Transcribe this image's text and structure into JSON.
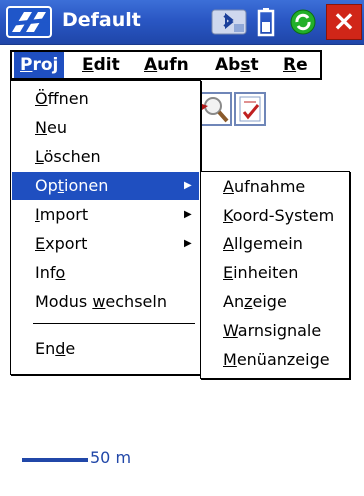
{
  "window": {
    "title": "Default"
  },
  "menubar": {
    "items": [
      {
        "label": "Proj",
        "u": "P",
        "rest": "roj"
      },
      {
        "label": "Edit",
        "u": "E",
        "rest": "dit"
      },
      {
        "label": "Aufn",
        "u": "A",
        "rest": "ufn"
      },
      {
        "label": "Abst",
        "pre": "Ab",
        "u": "s",
        "rest": "t"
      },
      {
        "label": "Re",
        "u": "R",
        "rest": "e"
      }
    ]
  },
  "proj_menu": {
    "items": [
      {
        "label": "Öffnen",
        "u": "Ö",
        "rest": "ffnen"
      },
      {
        "label": "Neu",
        "u": "N",
        "rest": "eu"
      },
      {
        "label": "Löschen",
        "u": "L",
        "rest": "öschen"
      },
      {
        "label": "Optionen",
        "pre": "Op",
        "u": "t",
        "rest": "ionen",
        "submenu": true
      },
      {
        "label": "Import",
        "u": "I",
        "rest": "mport",
        "submenu": true
      },
      {
        "label": "Export",
        "u": "E",
        "rest": "xport",
        "submenu": true
      },
      {
        "label": "Info",
        "pre": "Inf",
        "u": "o",
        "rest": ""
      },
      {
        "label": "Modus wechseln",
        "pre": "Modus ",
        "u": "w",
        "rest": "echseln"
      },
      {
        "label": "Ende",
        "pre": "En",
        "u": "d",
        "rest": "e"
      }
    ]
  },
  "optionen_submenu": {
    "items": [
      {
        "label": "Aufnahme",
        "u": "A",
        "rest": "ufnahme"
      },
      {
        "label": "Koord-System",
        "u": "K",
        "rest": "oord-System"
      },
      {
        "label": "Allgemein",
        "u": "A",
        "rest": "llgemein"
      },
      {
        "label": "Einheiten",
        "u": "E",
        "rest": "inheiten"
      },
      {
        "label": "Anzeige",
        "pre": "An",
        "u": "z",
        "rest": "eige"
      },
      {
        "label": "Warnsignale",
        "u": "W",
        "rest": "arnsignale"
      },
      {
        "label": "Menüanzeige",
        "u": "M",
        "rest": "enüanzeige"
      }
    ]
  },
  "map": {
    "scale_label": "50 m"
  },
  "icons": {
    "logo": "app-logo",
    "tray": [
      "bluetooth-icon",
      "battery-icon",
      "sync-icon"
    ],
    "close": "close-icon",
    "toolbar": [
      "zoom-icon",
      "checklist-icon"
    ]
  },
  "colors": {
    "titlebar": "#2a57c4",
    "highlight": "#1f4fc0",
    "close": "#d02618"
  }
}
